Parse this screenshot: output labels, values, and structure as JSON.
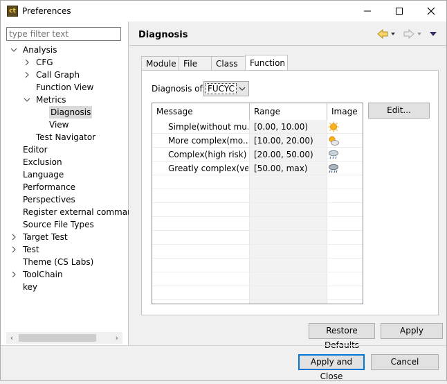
{
  "window": {
    "title": "Preferences",
    "app_icon_text": "ct"
  },
  "filter": {
    "placeholder": "type filter text"
  },
  "tree": [
    {
      "label": "Analysis",
      "level": 0,
      "twisty": "expanded"
    },
    {
      "label": "CFG",
      "level": 1,
      "twisty": "collapsed"
    },
    {
      "label": "Call Graph",
      "level": 1,
      "twisty": "collapsed"
    },
    {
      "label": "Function View",
      "level": 1,
      "twisty": "none"
    },
    {
      "label": "Metrics",
      "level": 1,
      "twisty": "expanded"
    },
    {
      "label": "Diagnosis",
      "level": 2,
      "twisty": "none",
      "selected": true
    },
    {
      "label": "View",
      "level": 2,
      "twisty": "none"
    },
    {
      "label": "Test Navigator",
      "level": 1,
      "twisty": "none"
    },
    {
      "label": "Editor",
      "level": 0,
      "twisty": "none"
    },
    {
      "label": "Exclusion",
      "level": 0,
      "twisty": "none"
    },
    {
      "label": "Language",
      "level": 0,
      "twisty": "none"
    },
    {
      "label": "Performance",
      "level": 0,
      "twisty": "none"
    },
    {
      "label": "Perspectives",
      "level": 0,
      "twisty": "none"
    },
    {
      "label": "Register external comman",
      "level": 0,
      "twisty": "none"
    },
    {
      "label": "Source File Types",
      "level": 0,
      "twisty": "none"
    },
    {
      "label": "Target Test",
      "level": 0,
      "twisty": "collapsed"
    },
    {
      "label": "Test",
      "level": 0,
      "twisty": "collapsed"
    },
    {
      "label": "Theme (CS Labs)",
      "level": 0,
      "twisty": "none"
    },
    {
      "label": "ToolChain",
      "level": 0,
      "twisty": "collapsed"
    },
    {
      "label": "key",
      "level": 0,
      "twisty": "none"
    }
  ],
  "page": {
    "title": "Diagnosis"
  },
  "tabs": [
    {
      "label": "Module",
      "active": false
    },
    {
      "label": "File",
      "active": false
    },
    {
      "label": "Class",
      "active": false
    },
    {
      "label": "Function",
      "active": true
    }
  ],
  "diagnosis": {
    "label": "Diagnosis of:",
    "selected": "FUCYC"
  },
  "table": {
    "headers": {
      "message": "Message",
      "range": "Range",
      "image": "Image"
    },
    "rows": [
      {
        "message": "Simple(without mu...",
        "range": "[0.00, 10.00)",
        "icon": "sun-icon"
      },
      {
        "message": "More complex(mo...",
        "range": "[10.00, 20.00)",
        "icon": "sun-cloud-icon"
      },
      {
        "message": "Complex(high risk)",
        "range": "[20.00, 50.00)",
        "icon": "cloud-rain-icon"
      },
      {
        "message": "Greatly complex(ve...",
        "range": "[50.00, max)",
        "icon": "storm-icon"
      }
    ]
  },
  "buttons": {
    "edit": "Edit...",
    "restore_defaults": "Restore Defaults",
    "apply": "Apply",
    "apply_and_close": "Apply and Close",
    "cancel": "Cancel"
  }
}
